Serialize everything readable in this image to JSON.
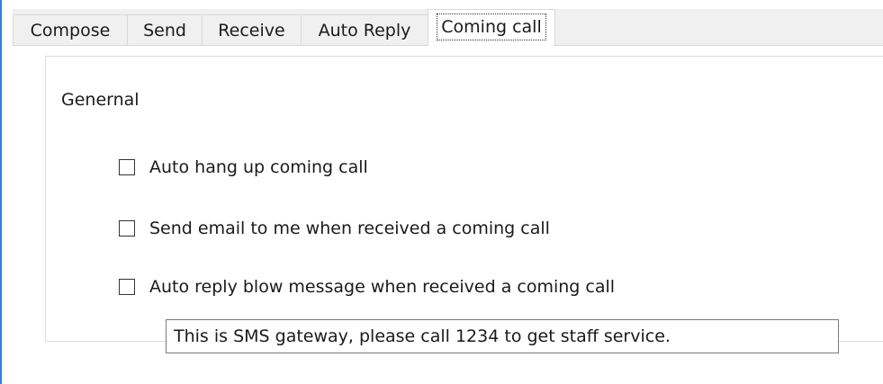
{
  "tabs": [
    {
      "label": "Compose",
      "active": false
    },
    {
      "label": "Send",
      "active": false
    },
    {
      "label": "Receive",
      "active": false
    },
    {
      "label": "Auto Reply",
      "active": false
    },
    {
      "label": "Coming call",
      "active": true
    }
  ],
  "group": {
    "title": "Genernal"
  },
  "options": [
    {
      "label": "Auto hang up coming call",
      "checked": false
    },
    {
      "label": "Send email to me when received a coming call",
      "checked": false
    },
    {
      "label": "Auto reply blow message when received a coming call",
      "checked": false
    }
  ],
  "reply_message": {
    "value": "This is SMS gateway, please call 1234 to get staff service."
  },
  "colors": {
    "window_edge": "#3a7fc0",
    "tab_bg": "#f0f0f0",
    "content_bg": "#ffffff"
  }
}
